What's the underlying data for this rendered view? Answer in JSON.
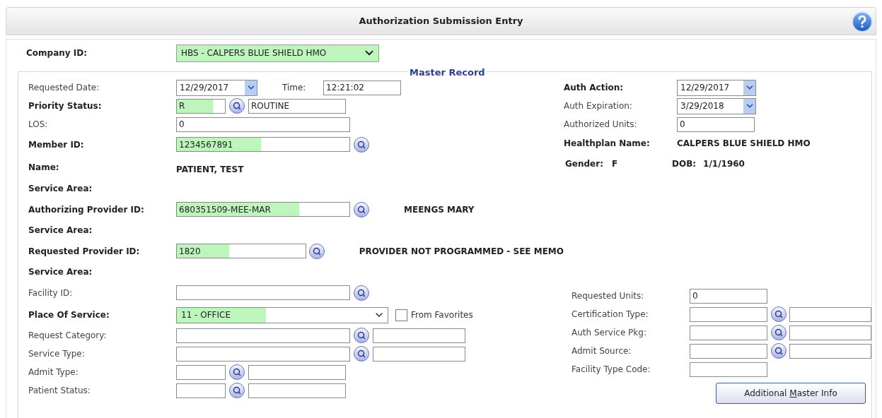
{
  "header": {
    "title": "Authorization Submission Entry"
  },
  "company": {
    "label": "Company ID:",
    "value": "HBS - CALPERS BLUE SHIELD HMO",
    "highlighted": true
  },
  "master_record": {
    "legend": "Master Record",
    "left": [
      {
        "kind": "date_time",
        "label": "Requested Date:",
        "required": false,
        "value": "12/29/2017",
        "time_label": "Time:",
        "time_value": "12:21:02"
      },
      {
        "kind": "code_lookup",
        "label": "Priority Status:",
        "required": true,
        "value": "R",
        "highlighted": true,
        "description": "ROUTINE"
      },
      {
        "kind": "text",
        "label": "LOS:",
        "required": false,
        "value": "0",
        "highlighted": false
      },
      {
        "kind": "lookup",
        "label": "Member ID:",
        "required": true,
        "value": "1234567891",
        "highlighted": true
      },
      {
        "kind": "display",
        "label": "Name:",
        "required": true,
        "value": "PATIENT, TEST"
      },
      {
        "kind": "section",
        "label": "Service Area:",
        "required": true
      },
      {
        "kind": "lookup",
        "label": "Authorizing Provider ID:",
        "required": true,
        "value": "680351509-MEE-MAR",
        "highlighted": true,
        "result": "MEENGS MARY"
      },
      {
        "kind": "section",
        "label": "Service Area:",
        "required": true
      },
      {
        "kind": "lookup",
        "label": "Requested Provider ID:",
        "required": true,
        "value": "1820",
        "highlighted": true,
        "result": "PROVIDER NOT PROGRAMMED - SEE MEMO"
      },
      {
        "kind": "section",
        "label": "Service Area:",
        "required": true
      },
      {
        "kind": "lookup",
        "label": "Facility ID:",
        "required": false
      },
      {
        "kind": "select",
        "label": "Place Of Service:",
        "required": true,
        "value": "11 - OFFICE",
        "highlighted": true,
        "option_label": "From Favorites",
        "checked": false
      },
      {
        "kind": "lookup_pair",
        "label": "Request Category:",
        "required": false
      },
      {
        "kind": "lookup_pair",
        "label": "Service Type:",
        "required": false
      },
      {
        "kind": "code_lookup",
        "label": "Admit Type:",
        "required": false
      },
      {
        "kind": "code_lookup",
        "label": "Patient Status:",
        "required": false
      }
    ],
    "right_top": [
      {
        "kind": "date",
        "label": "Auth Action:",
        "required": true,
        "value": "12/29/2017"
      },
      {
        "kind": "date",
        "label": "Auth Expiration:",
        "required": false,
        "value": "3/29/2018"
      },
      {
        "kind": "text",
        "label": "Authorized Units:",
        "required": false,
        "value": "0"
      },
      {
        "kind": "display",
        "label": "Healthplan Name:",
        "required": true,
        "value": "CALPERS BLUE SHIELD HMO"
      },
      {
        "kind": "pair",
        "label": "Gender:",
        "required": true,
        "value": "F",
        "label_2": "DOB:",
        "value_2": "1/1/1960"
      }
    ],
    "right_bottom": [
      {
        "kind": "text",
        "label": "Requested Units:",
        "required": false,
        "value": "0"
      },
      {
        "kind": "lookup_pair",
        "label": "Certification Type:",
        "required": false
      },
      {
        "kind": "lookup_pair",
        "label": "Auth Service Pkg:",
        "required": false
      },
      {
        "kind": "lookup_pair",
        "label": "Admit Source:",
        "required": false
      },
      {
        "kind": "text",
        "label": "Facility Type Code:",
        "required": false
      }
    ],
    "button": {
      "before": "Additional ",
      "access_key": "M",
      "after": "aster Info"
    }
  }
}
